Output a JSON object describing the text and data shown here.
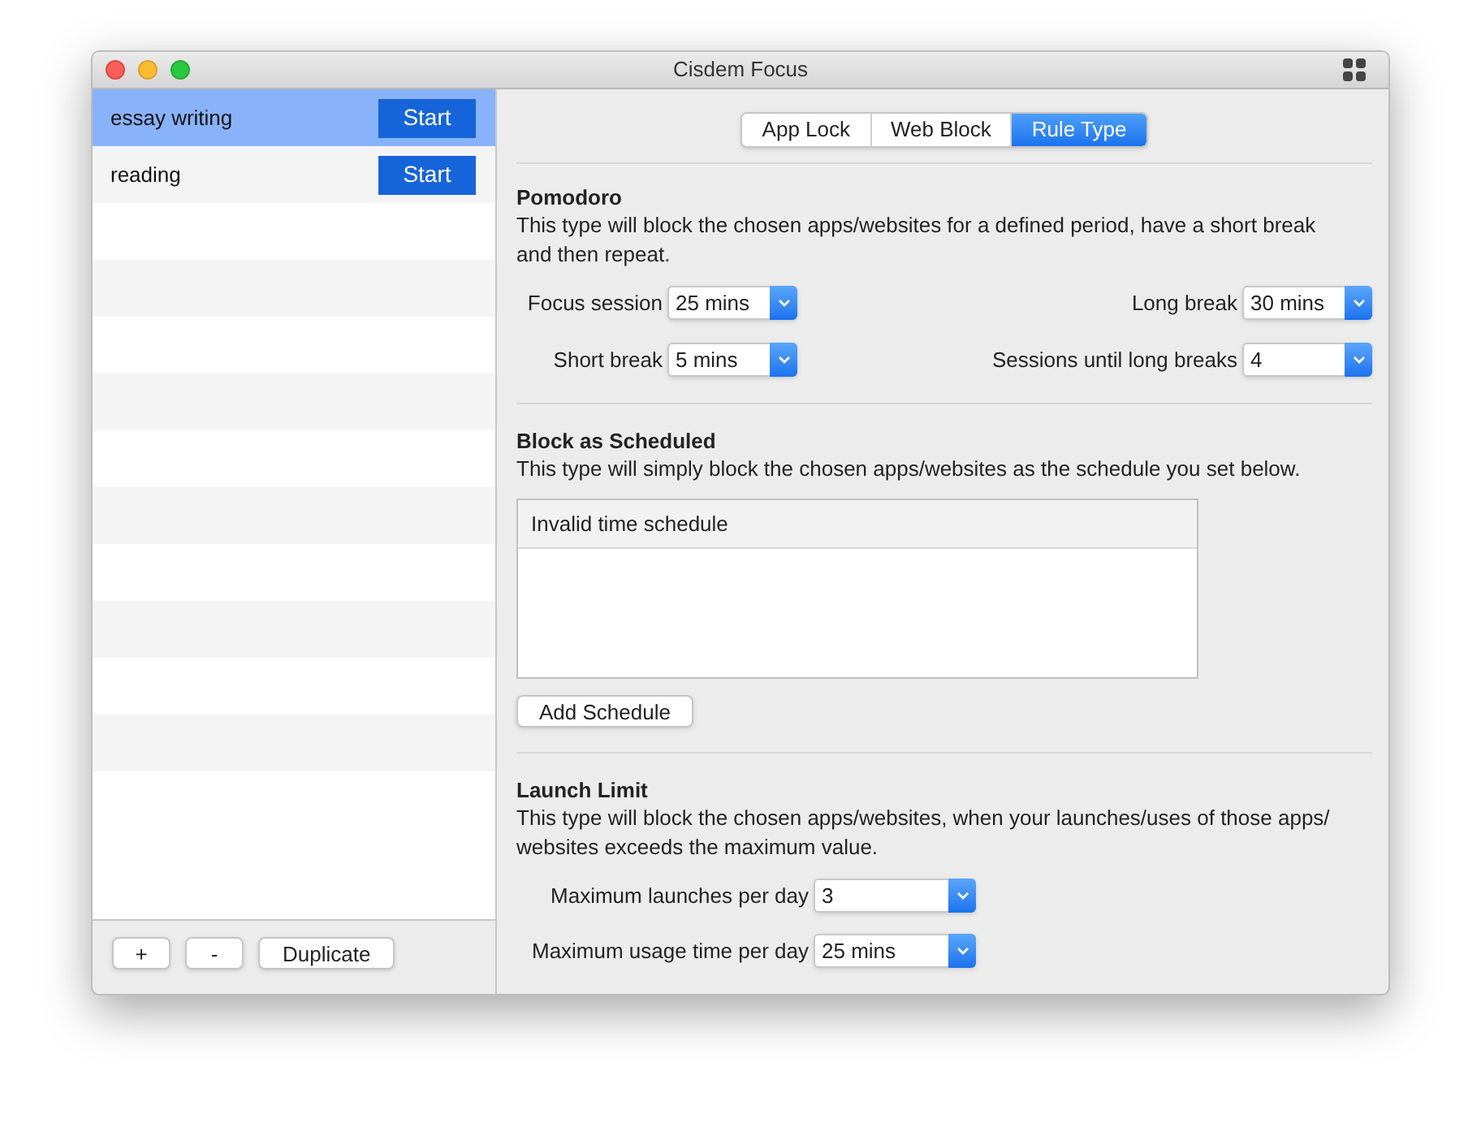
{
  "window": {
    "title": "Cisdem Focus"
  },
  "rules": [
    {
      "name": "essay writing",
      "button": "Start",
      "selected": true
    },
    {
      "name": "reading",
      "button": "Start",
      "selected": false
    }
  ],
  "sidebar_buttons": [
    "+",
    "-",
    "Duplicate"
  ],
  "tabs": [
    {
      "label": "App Lock",
      "selected": false
    },
    {
      "label": "Web Block",
      "selected": false
    },
    {
      "label": "Rule Type",
      "selected": true
    }
  ],
  "pomodoro": {
    "title": "Pomodoro",
    "description": "This type will block the chosen apps/websites for a defined period, have a short break and then repeat.",
    "fields": [
      {
        "label": "Focus session",
        "value": "25 mins"
      },
      {
        "label": "Long break",
        "value": "30 mins"
      },
      {
        "label": "Short break",
        "value": "5 mins"
      },
      {
        "label": "Sessions until long breaks",
        "value": "4"
      }
    ]
  },
  "scheduled": {
    "title": "Block as Scheduled",
    "description": "This type will simply block the chosen apps/websites as the schedule you set below.",
    "table_header": "Invalid time schedule",
    "button": "Add Schedule"
  },
  "launch_limit": {
    "title": "Launch Limit",
    "description": "This type will block the chosen apps/websites, when your launches/uses of those apps/ websites exceeds the maximum value.",
    "fields": [
      {
        "label": "Maximum launches per day",
        "value": "3"
      },
      {
        "label": "Maximum usage time per day",
        "value": "25 mins"
      }
    ]
  }
}
